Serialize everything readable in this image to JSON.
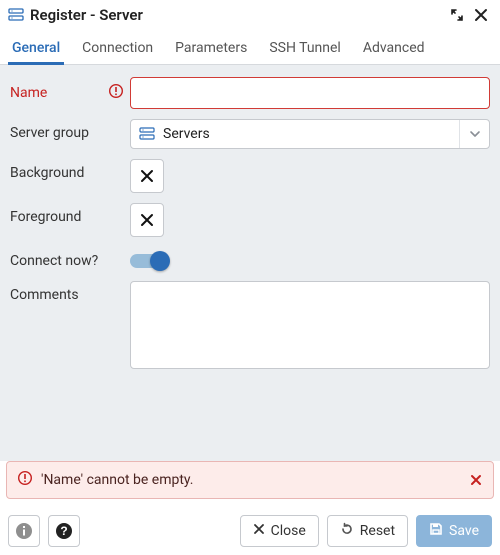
{
  "window": {
    "title": "Register - Server"
  },
  "tabs": [
    {
      "label": "General",
      "active": true
    },
    {
      "label": "Connection",
      "active": false
    },
    {
      "label": "Parameters",
      "active": false
    },
    {
      "label": "SSH Tunnel",
      "active": false
    },
    {
      "label": "Advanced",
      "active": false
    }
  ],
  "fields": {
    "name": {
      "label": "Name",
      "value": "",
      "error": true
    },
    "server_group": {
      "label": "Server group",
      "selected": "Servers"
    },
    "background": {
      "label": "Background",
      "value": null
    },
    "foreground": {
      "label": "Foreground",
      "value": null
    },
    "connect_now": {
      "label": "Connect now?",
      "value": true
    },
    "comments": {
      "label": "Comments",
      "value": ""
    }
  },
  "error_banner": {
    "message": "'Name' cannot be empty."
  },
  "footer": {
    "close": "Close",
    "reset": "Reset",
    "save": "Save"
  }
}
